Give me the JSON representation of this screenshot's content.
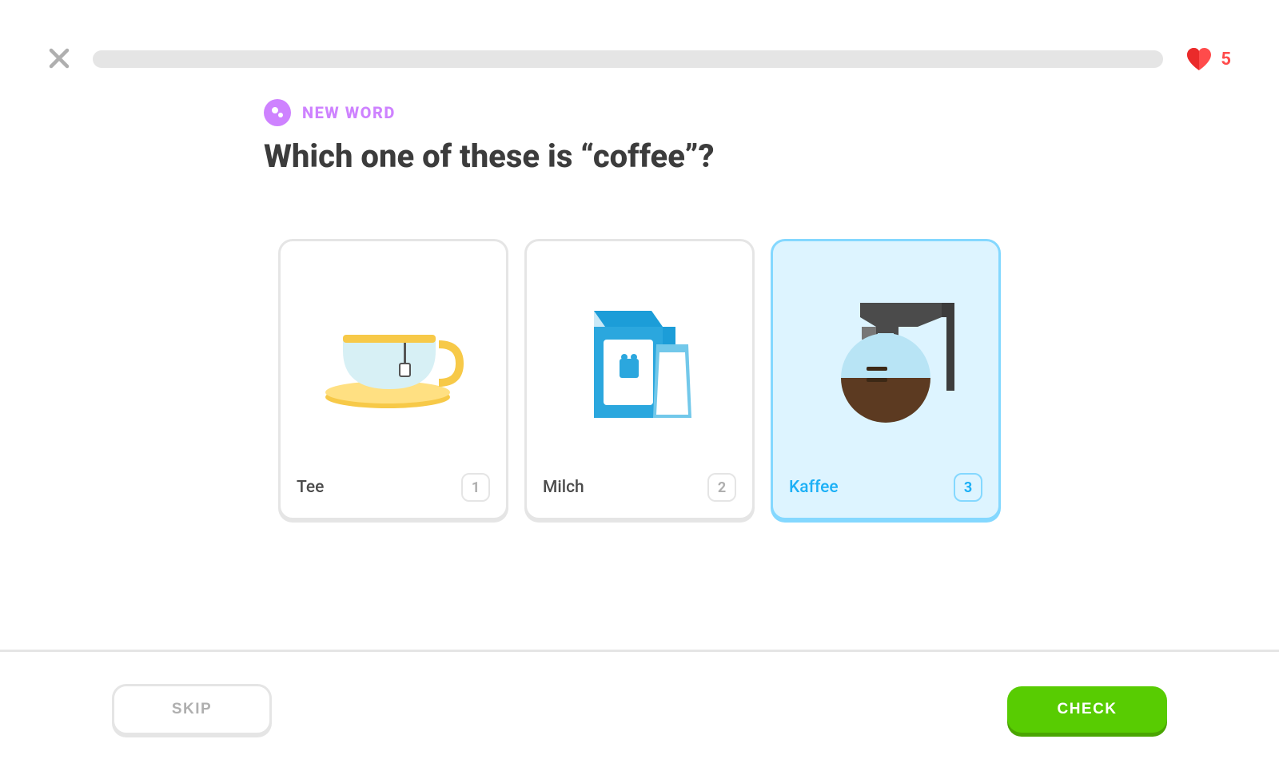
{
  "header": {
    "heart_count": "5"
  },
  "badge": {
    "label": "NEW WORD"
  },
  "prompt": "Which one of these is “coffee”?",
  "cards": [
    {
      "label": "Tee",
      "num": "1",
      "selected": false,
      "icon": "tea"
    },
    {
      "label": "Milch",
      "num": "2",
      "selected": false,
      "icon": "milk"
    },
    {
      "label": "Kaffee",
      "num": "3",
      "selected": true,
      "icon": "coffee"
    }
  ],
  "footer": {
    "skip_label": "SKIP",
    "check_label": "CHECK"
  }
}
